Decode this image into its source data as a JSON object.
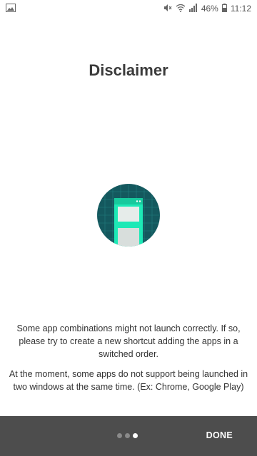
{
  "status_bar": {
    "battery_percent": "46%",
    "time": "11:12",
    "icons": [
      "image-notification-icon",
      "mute-icon",
      "wifi-icon",
      "signal-icon",
      "battery-icon"
    ]
  },
  "page": {
    "title": "Disclaimer",
    "illustration_icon": "split-window-icon",
    "paragraph1": "Some app combinations might not launch correctly. If so, please try to create a new shortcut adding the apps in a switched order.",
    "paragraph2": "At the moment, some apps do not support being launched in two windows at the same time. (Ex: Chrome, Google Play)"
  },
  "bottom_bar": {
    "done_label": "DONE",
    "page_indicator": {
      "total": 3,
      "current": 3
    }
  },
  "colors": {
    "illustration_bg": "#14585e",
    "illustration_accent": "#1de9b6",
    "bottom_bar": "#4d4d4d"
  }
}
